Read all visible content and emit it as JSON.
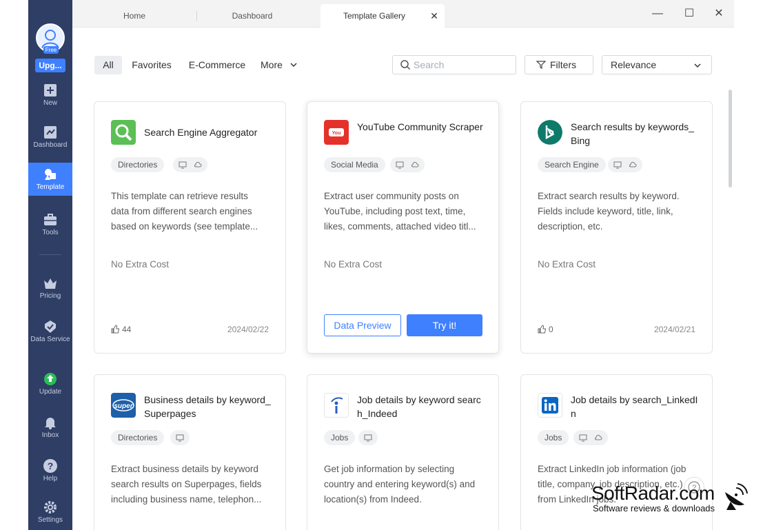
{
  "sidebar": {
    "free_label": "Free",
    "upgrade_label": "Upg...",
    "items": [
      {
        "label": "New",
        "icon": "plus-box-icon"
      },
      {
        "label": "Dashboard",
        "icon": "dashboard-flag-icon"
      },
      {
        "label": "Template",
        "icon": "template-shapes-icon"
      },
      {
        "label": "Tools",
        "icon": "toolbox-icon"
      },
      {
        "label": "Pricing",
        "icon": "crown-icon"
      },
      {
        "label": "Data Service",
        "icon": "check-badge-icon"
      },
      {
        "label": "Update",
        "icon": "update-arrow-icon"
      },
      {
        "label": "Inbox",
        "icon": "bell-icon"
      },
      {
        "label": "Help",
        "icon": "question-icon"
      },
      {
        "label": "Settings",
        "icon": "gear-icon"
      }
    ],
    "active": "Template"
  },
  "tabs": [
    {
      "label": "Home"
    },
    {
      "label": "Dashboard"
    },
    {
      "label": "Template Gallery"
    }
  ],
  "filter_bar": {
    "categories": [
      "All",
      "Favorites",
      "E-Commerce",
      "More"
    ],
    "search_placeholder": "Search",
    "filters_label": "Filters",
    "sort_value": "Relevance"
  },
  "cards": [
    {
      "title": "Search Engine Aggregator",
      "tag": "Directories",
      "desc": [
        "This template can retrieve results",
        "data from different search engines",
        "based on keywords (see template..."
      ],
      "cost": "No Extra Cost",
      "likes": "44",
      "date": "2024/02/22"
    },
    {
      "title": "YouTube Community Scraper",
      "tag": "Social Media",
      "desc": [
        "Extract user community posts on",
        "YouTube, including post text, time,",
        "likes, comments, attached video titl..."
      ],
      "cost": "No Extra Cost",
      "preview_label": "Data Preview",
      "try_label": "Try it!"
    },
    {
      "title": "Search results by keywords_Bing",
      "tag": "Search Engine",
      "desc": [
        "Extract search results by keyword.",
        "Fields include keyword, title, link,",
        "description, etc."
      ],
      "cost": "No Extra Cost",
      "likes": "0",
      "date": "2024/02/21"
    },
    {
      "title": "Business details by keyword_Superpages",
      "tag": "Directories",
      "desc": [
        "Extract business details by keyword",
        "search results on Superpages, fields",
        "including business name, telephon..."
      ]
    },
    {
      "title": "Job details by keyword search_Indeed",
      "tag": "Jobs",
      "desc": [
        "Get job information by selecting",
        "country and entering keyword(s) and",
        "location(s) from Indeed."
      ]
    },
    {
      "title": "Job details by search_LinkedIn",
      "tag": "Jobs",
      "desc": [
        "Extract LinkedIn job information (job",
        "title, company, job description, etc.)",
        "from LinkedIn jobs."
      ]
    }
  ],
  "watermark": {
    "brand": "SoftRadar.com",
    "tagline": "Software reviews & downloads"
  },
  "colors": {
    "sidebar": "#2e3e65",
    "accent": "#3f80ff"
  }
}
